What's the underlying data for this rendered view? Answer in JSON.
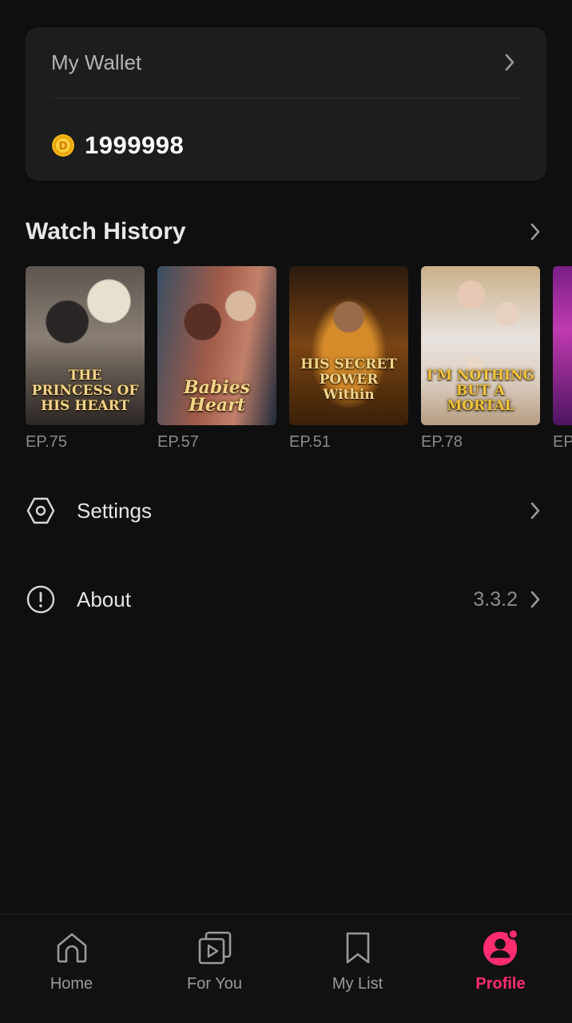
{
  "wallet": {
    "title": "My Wallet",
    "balance": "1999998"
  },
  "history": {
    "title": "Watch History",
    "items": [
      {
        "title": "THE PRINCESS OF HIS HEART",
        "episode": "EP.75"
      },
      {
        "title": "Babies Heart",
        "episode": "EP.57"
      },
      {
        "title": "HIS SECRET POWER Within",
        "episode": "EP.51"
      },
      {
        "title": "I'M NOTHING BUT A MORTAL",
        "episode": "EP.78"
      },
      {
        "title": "",
        "episode": "EP"
      }
    ]
  },
  "menu": {
    "settings": {
      "label": "Settings",
      "icon": "settings-hexagon-icon"
    },
    "about": {
      "label": "About",
      "value": "3.3.2",
      "icon": "info-circle-icon"
    }
  },
  "tabs": [
    {
      "label": "Home",
      "icon": "home-icon",
      "active": false
    },
    {
      "label": "For You",
      "icon": "play-stack-icon",
      "active": false
    },
    {
      "label": "My List",
      "icon": "bookmark-icon",
      "active": false
    },
    {
      "label": "Profile",
      "icon": "profile-icon",
      "active": true
    }
  ],
  "colors": {
    "accent": "#ff2d6f",
    "background": "#0f0f0f",
    "card": "#1d1d1d"
  }
}
